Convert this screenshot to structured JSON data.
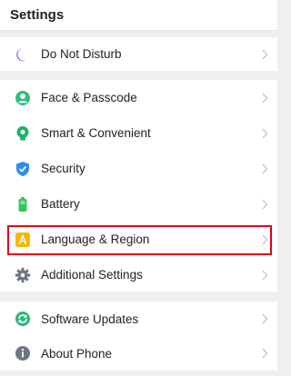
{
  "header": {
    "title": "Settings"
  },
  "groups": [
    {
      "items": [
        {
          "label": "Do Not Disturb",
          "icon": "moon-icon"
        }
      ]
    },
    {
      "items": [
        {
          "label": "Face & Passcode",
          "icon": "face-passcode-icon"
        },
        {
          "label": "Smart & Convenient",
          "icon": "smart-convenient-icon"
        },
        {
          "label": "Security",
          "icon": "shield-icon"
        },
        {
          "label": "Battery",
          "icon": "battery-icon"
        },
        {
          "label": "Language & Region",
          "icon": "language-icon"
        },
        {
          "label": "Additional Settings",
          "icon": "gear-icon"
        }
      ]
    },
    {
      "items": [
        {
          "label": "Software Updates",
          "icon": "software-update-icon"
        },
        {
          "label": "About Phone",
          "icon": "info-icon"
        }
      ]
    }
  ],
  "colors": {
    "moon": "#8a5cf6",
    "face": "#2cbf7a",
    "smart": "#21b364",
    "security": "#2d8cf0",
    "battery": "#34c759",
    "language": "#f5b700",
    "gear": "#6f7680",
    "update": "#2db47d",
    "info": "#6f7680",
    "highlight": "#e0001b"
  }
}
